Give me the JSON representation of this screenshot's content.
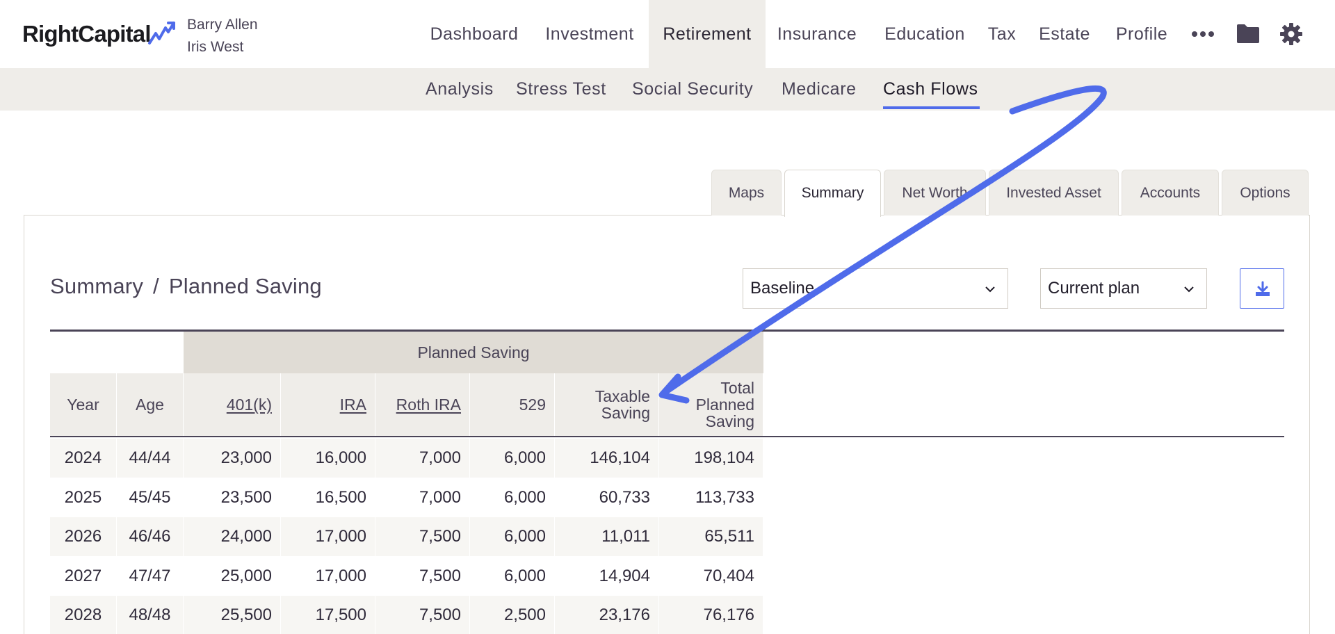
{
  "app": {
    "logo_text": "RightCapital"
  },
  "clients": {
    "primary": "Barry Allen",
    "secondary": "Iris West"
  },
  "nav": {
    "items": [
      "Dashboard",
      "Investment",
      "Retirement",
      "Insurance",
      "Education",
      "Tax",
      "Estate",
      "Profile"
    ],
    "active": "Retirement",
    "icons": [
      "more-icon",
      "folder-icon",
      "gear-icon"
    ]
  },
  "subnav": {
    "items": [
      "Analysis",
      "Stress Test",
      "Social Security",
      "Medicare",
      "Cash Flows"
    ],
    "active": "Cash Flows"
  },
  "tabs": {
    "items": [
      "Maps",
      "Summary",
      "Net Worth",
      "Invested Asset",
      "Accounts",
      "Options"
    ],
    "active": "Summary"
  },
  "breadcrumb": {
    "parent": "Summary",
    "separator": "/",
    "current": "Planned Saving"
  },
  "filters": {
    "scenario": "Baseline",
    "plan": "Current plan"
  },
  "table": {
    "group_header": "Planned Saving",
    "columns": [
      "Year",
      "Age",
      "401(k)",
      "IRA",
      "Roth IRA",
      "529",
      "Taxable Saving",
      "Total Planned Saving"
    ],
    "taxable_lines": [
      "Taxable",
      "Saving"
    ],
    "total_lines": [
      "Total",
      "Planned",
      "Saving"
    ],
    "rows": [
      [
        "2024",
        "44/44",
        "23,000",
        "16,000",
        "7,000",
        "6,000",
        "146,104",
        "198,104"
      ],
      [
        "2025",
        "45/45",
        "23,500",
        "16,500",
        "7,000",
        "6,000",
        "60,733",
        "113,733"
      ],
      [
        "2026",
        "46/46",
        "24,000",
        "17,000",
        "7,500",
        "6,000",
        "11,011",
        "65,511"
      ],
      [
        "2027",
        "47/47",
        "25,000",
        "17,000",
        "7,500",
        "6,000",
        "14,904",
        "70,404"
      ],
      [
        "2028",
        "48/48",
        "25,500",
        "17,500",
        "7,500",
        "2,500",
        "23,176",
        "76,176"
      ]
    ]
  },
  "colors": {
    "accent": "#4f6bea",
    "annotation_arrow": "#4f6bea",
    "subnav_bg": "#efede9",
    "group_header_bg": "#e0dcd5"
  }
}
